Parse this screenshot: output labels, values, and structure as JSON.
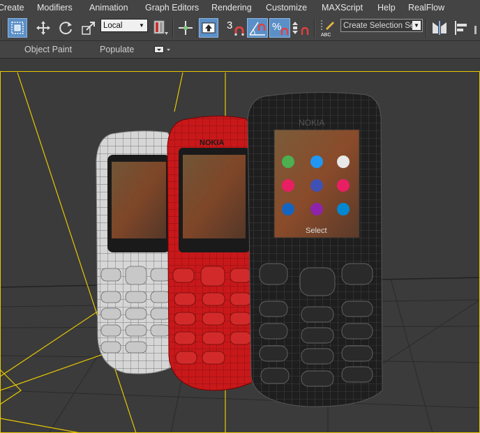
{
  "menubar": {
    "items": [
      "Create",
      "Modifiers",
      "Animation",
      "Graph Editors",
      "Rendering",
      "Customize",
      "MAXScript",
      "Help",
      "RealFlow"
    ]
  },
  "toolbar": {
    "reference_coord_value": "Local",
    "snap_value": "3",
    "named_selection_placeholder": "Create Selection Se",
    "icons": [
      "select-region-icon",
      "move-icon",
      "rotate-icon",
      "scale-icon",
      "pivot-icon",
      "select-manipulate-icon",
      "keyboard-shortcut-icon",
      "snap-toggle-icon",
      "angle-snap-icon",
      "percent-snap-icon",
      "spinner-snap-icon",
      "edit-named-selection-icon",
      "mirror-icon",
      "align-icon"
    ]
  },
  "ribbon": {
    "tabs": [
      "Object Paint",
      "Populate"
    ],
    "options_icon": "ribbon-options-icon"
  },
  "viewport": {
    "frame_color": "#e8c800",
    "grid_color": "#2a2a2a",
    "models": [
      {
        "name": "white-phone",
        "color": "#d8d8d8"
      },
      {
        "name": "red-phone",
        "color": "#c8181a"
      },
      {
        "name": "black-phone",
        "color": "#1e1e1e"
      }
    ],
    "screen_softkey": "Select",
    "brand": "NOKIA"
  }
}
